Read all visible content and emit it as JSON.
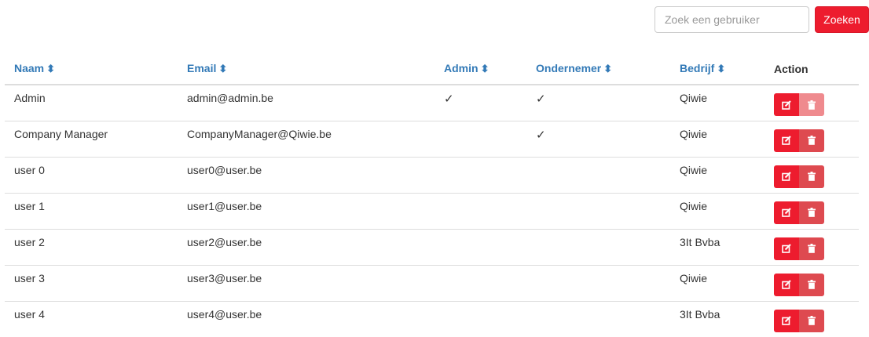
{
  "search": {
    "placeholder": "Zoek een gebruiker",
    "button_label": "Zoeken"
  },
  "table": {
    "columns": [
      {
        "label": "Naam",
        "sortable": true
      },
      {
        "label": "Email",
        "sortable": true
      },
      {
        "label": "Admin",
        "sortable": true
      },
      {
        "label": "Ondernemer",
        "sortable": true
      },
      {
        "label": "Bedrijf",
        "sortable": true
      },
      {
        "label": "Action",
        "sortable": false
      }
    ],
    "sort_icon": "sort-icon",
    "check_mark": "✓",
    "rows": [
      {
        "name": "Admin",
        "email": "admin@admin.be",
        "admin": true,
        "ondernemer": true,
        "company": "Qiwie"
      },
      {
        "name": "Company Manager",
        "email": "CompanyManager@Qiwie.be",
        "admin": false,
        "ondernemer": true,
        "company": "Qiwie"
      },
      {
        "name": "user 0",
        "email": "user0@user.be",
        "admin": false,
        "ondernemer": false,
        "company": "Qiwie"
      },
      {
        "name": "user 1",
        "email": "user1@user.be",
        "admin": false,
        "ondernemer": false,
        "company": "Qiwie"
      },
      {
        "name": "user 2",
        "email": "user2@user.be",
        "admin": false,
        "ondernemer": false,
        "company": "3It Bvba"
      },
      {
        "name": "user 3",
        "email": "user3@user.be",
        "admin": false,
        "ondernemer": false,
        "company": "Qiwie"
      },
      {
        "name": "user 4",
        "email": "user4@user.be",
        "admin": false,
        "ondernemer": false,
        "company": "3It Bvba"
      }
    ]
  },
  "colors": {
    "accent": "#ed1c2e",
    "link": "#337ab7",
    "delete": "#de4a50",
    "delete_disabled": "#ef8a8e"
  }
}
